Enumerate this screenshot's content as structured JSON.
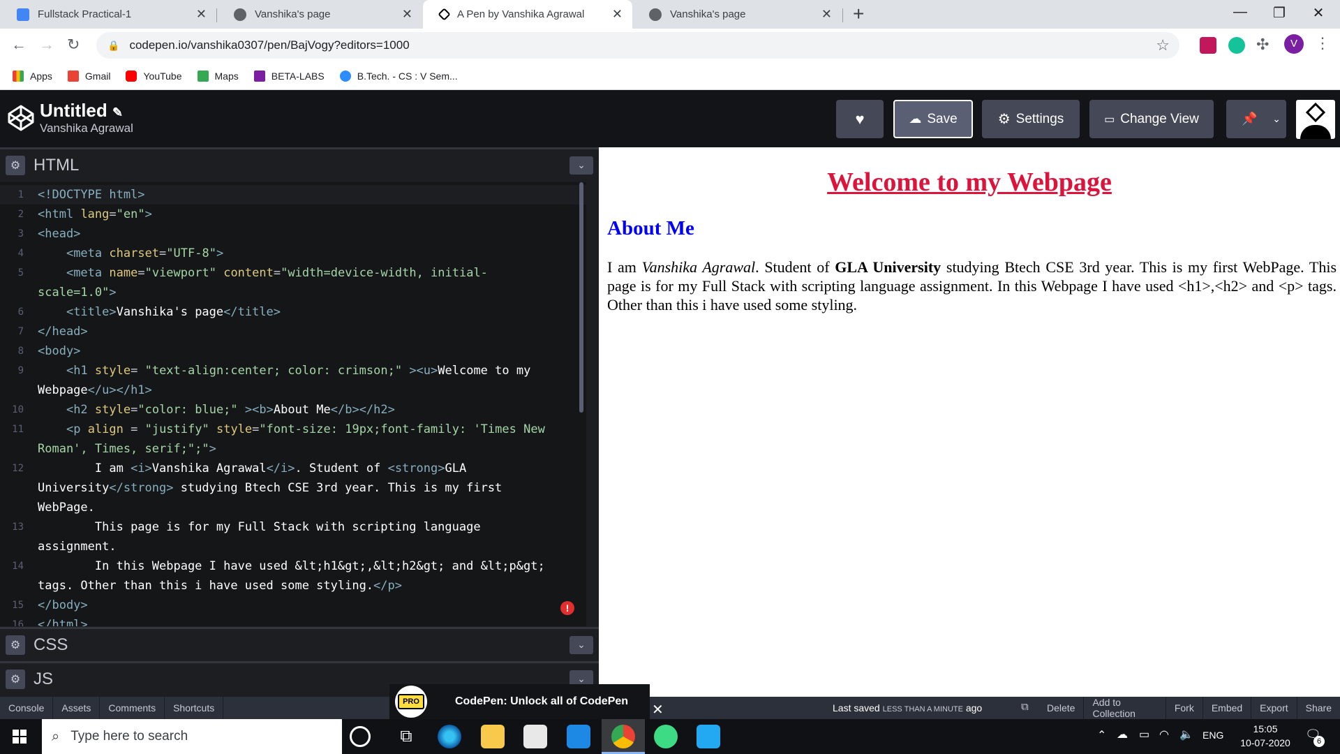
{
  "browser": {
    "tabs": [
      {
        "label": "Fullstack Practical-1",
        "favicon": "docs-icon",
        "color": "#4285f4"
      },
      {
        "label": "Vanshika's page",
        "favicon": "globe-icon",
        "color": "#5f6368"
      },
      {
        "label": "A Pen by Vanshika Agrawal",
        "favicon": "codepen-icon",
        "color": "#000000"
      },
      {
        "label": "Vanshika's page",
        "favicon": "globe-icon",
        "color": "#5f6368"
      }
    ],
    "url": "codepen.io/vanshika0307/pen/BajVogy?editors=1000",
    "profile_initial": "V",
    "bookmarks": [
      {
        "label": "Apps",
        "color": "#ea4335"
      },
      {
        "label": "Gmail",
        "color": "#ea4335"
      },
      {
        "label": "YouTube",
        "color": "#ff0000"
      },
      {
        "label": "Maps",
        "color": "#34a853"
      },
      {
        "label": "BETA-LABS",
        "color": "#7b1fa2"
      },
      {
        "label": "B.Tech. - CS : V Sem...",
        "color": "#2d8cff"
      }
    ]
  },
  "codepen": {
    "title": "Untitled",
    "author": "Vanshika Agrawal",
    "buttons": {
      "save": "Save",
      "settings": "Settings",
      "change_view": "Change View"
    },
    "panels": {
      "html": "HTML",
      "css": "CSS",
      "js": "JS"
    },
    "footer": {
      "left": [
        "Console",
        "Assets",
        "Comments",
        "Shortcuts"
      ],
      "last_saved_prefix": "Last saved",
      "last_saved_time": "LESS THAN A MINUTE",
      "last_saved_suffix": "ago",
      "right": [
        "Delete",
        "Add to Collection",
        "Fork",
        "Embed",
        "Export",
        "Share"
      ]
    },
    "promo": {
      "badge": "PRO",
      "text": "CodePen: Unlock all of CodePen"
    }
  },
  "code_lines": [
    {
      "n": "1",
      "html": "<span class='tg'>&lt;!DOCTYPE html&gt;</span>"
    },
    {
      "n": "2",
      "html": "<span class='tg'>&lt;html</span> <span class='at'>lang</span>=<span class='sv'>\"en\"</span><span class='tg'>&gt;</span>"
    },
    {
      "n": "3",
      "html": "<span class='tg'>&lt;head&gt;</span>"
    },
    {
      "n": "4",
      "html": "    <span class='tg'>&lt;meta</span> <span class='at'>charset</span>=<span class='sv'>\"UTF-8\"</span><span class='tg'>&gt;</span>"
    },
    {
      "n": "5",
      "html": "    <span class='tg'>&lt;meta</span> <span class='at'>name</span>=<span class='sv'>\"viewport\"</span> <span class='at'>content</span>=<span class='sv'>\"width=device-width, initial-</span>"
    },
    {
      "n": "",
      "html": "<span class='sv'>scale=1.0\"</span><span class='tg'>&gt;</span>"
    },
    {
      "n": "6",
      "html": "    <span class='tg'>&lt;title&gt;</span><span class='tx'>Vanshika's page</span><span class='tg'>&lt;/title&gt;</span>"
    },
    {
      "n": "7",
      "html": "<span class='tg'>&lt;/head&gt;</span>"
    },
    {
      "n": "8",
      "html": "<span class='tg'>&lt;body&gt;</span>"
    },
    {
      "n": "9",
      "html": "    <span class='tg'>&lt;h1</span> <span class='at'>style</span>= <span class='sv'>\"text-align:center; color: crimson;\"</span> <span class='tg'>&gt;&lt;u&gt;</span><span class='tx'>Welcome to my</span>"
    },
    {
      "n": "",
      "html": "<span class='tx'>Webpage</span><span class='tg'>&lt;/u&gt;&lt;/h1&gt;</span>"
    },
    {
      "n": "10",
      "html": "    <span class='tg'>&lt;h2</span> <span class='at'>style</span>=<span class='sv'>\"color: blue;\"</span> <span class='tg'>&gt;&lt;b&gt;</span><span class='tx'>About Me</span><span class='tg'>&lt;/b&gt;&lt;/h2&gt;</span>"
    },
    {
      "n": "11",
      "html": "    <span class='tg'>&lt;p</span> <span class='at'>align</span> = <span class='sv'>\"justify\"</span> <span class='at'>style</span>=<span class='sv'>\"font-size: 19px;font-family: 'Times New</span>"
    },
    {
      "n": "",
      "html": "<span class='sv'>Roman', Times, serif;\";\"</span><span class='tg'>&gt;</span>"
    },
    {
      "n": "12",
      "html": "        <span class='tx'>I am </span><span class='tg'>&lt;i&gt;</span><span class='tx'>Vanshika Agrawal</span><span class='tg'>&lt;/i&gt;</span><span class='tx'>. Student of </span><span class='tg'>&lt;strong&gt;</span><span class='tx'>GLA</span>"
    },
    {
      "n": "",
      "html": "<span class='tx'>University</span><span class='tg'>&lt;/strong&gt;</span><span class='tx'> studying Btech CSE 3rd year. This is my first</span>"
    },
    {
      "n": "",
      "html": "<span class='tx'>WebPage.</span>"
    },
    {
      "n": "13",
      "html": "        <span class='tx'>This page is for my Full Stack with scripting language</span>"
    },
    {
      "n": "",
      "html": "<span class='tx'>assignment.</span>"
    },
    {
      "n": "14",
      "html": "        <span class='tx'>In this Webpage I have used &amp;lt;h1&amp;gt;,&amp;lt;h2&amp;gt; and &amp;lt;p&amp;gt;</span>"
    },
    {
      "n": "",
      "html": "<span class='tx'>tags. Other than this i have used some styling.</span><span class='tg'>&lt;/p&gt;</span>"
    },
    {
      "n": "15",
      "html": "<span class='tg'>&lt;/body&gt;</span>"
    },
    {
      "n": "16",
      "html": "<span class='tg'>&lt;/html&gt;</span>"
    }
  ],
  "preview": {
    "h1": "Welcome to my Webpage",
    "h2": "About Me",
    "p_1": "I am ",
    "p_name": "Vanshika Agrawal",
    "p_2": ". Student of ",
    "p_uni": "GLA University",
    "p_3": " studying Btech CSE 3rd year. This is my first WebPage. This page is for my Full Stack with scripting language assignment. In this Webpage I have used <h1>,<h2> and <p> tags. Other than this i have used some styling."
  },
  "taskbar": {
    "search_placeholder": "Type here to search",
    "lang": "ENG",
    "time": "15:05",
    "date": "10-07-2020",
    "notifications": "6"
  }
}
